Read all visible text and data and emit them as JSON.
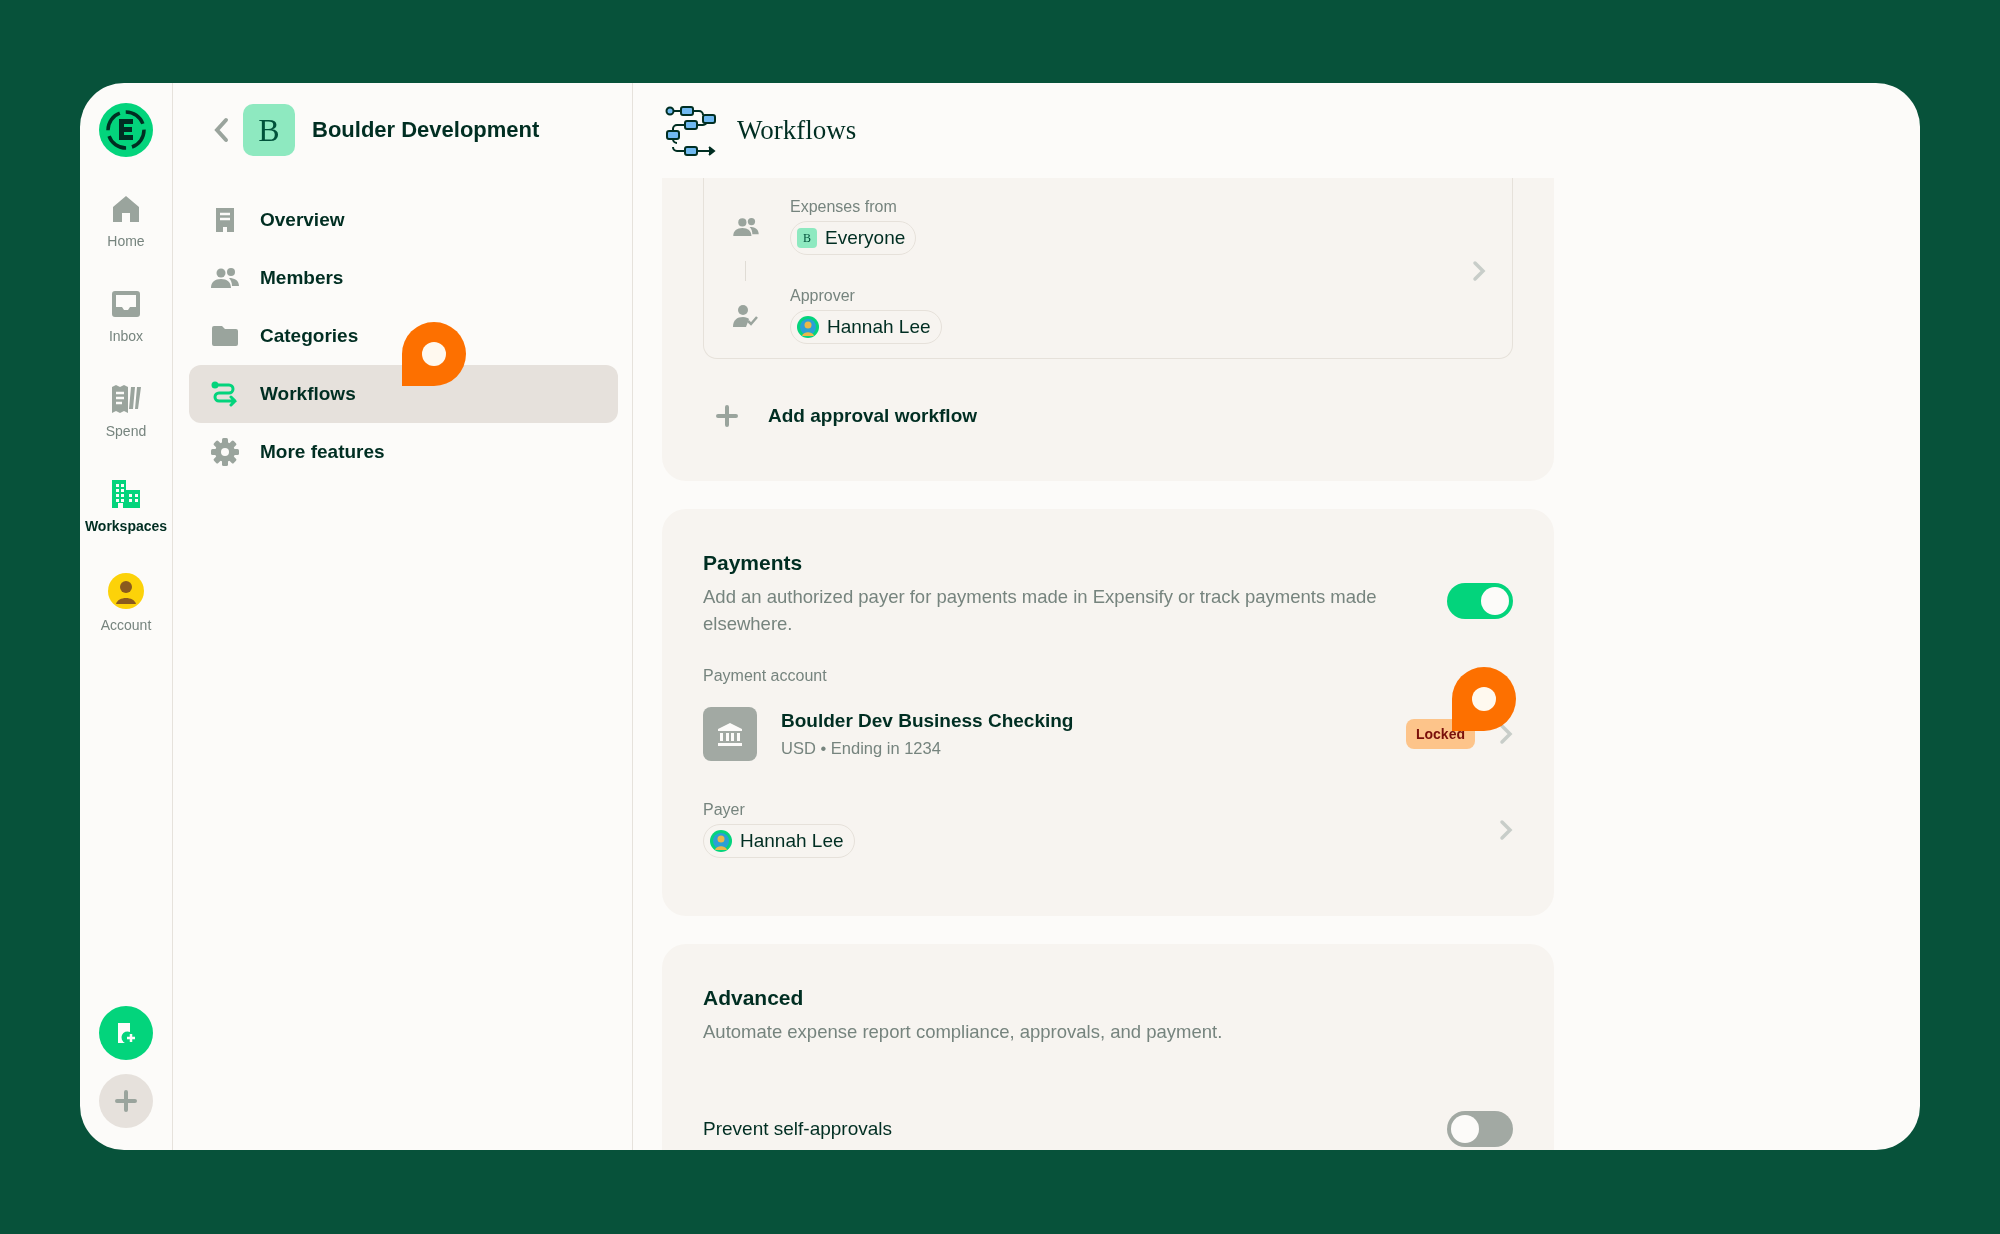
{
  "rail": {
    "items": [
      {
        "label": "Home",
        "kind": "home",
        "selected": false
      },
      {
        "label": "Inbox",
        "kind": "inbox",
        "selected": false
      },
      {
        "label": "Spend",
        "kind": "spend",
        "selected": false
      },
      {
        "label": "Workspaces",
        "kind": "workspaces",
        "selected": true
      },
      {
        "label": "Account",
        "kind": "account",
        "selected": false
      }
    ]
  },
  "workspace": {
    "initial": "B",
    "name": "Boulder Development"
  },
  "menu": [
    {
      "label": "Overview",
      "kind": "overview",
      "selected": false
    },
    {
      "label": "Members",
      "kind": "members",
      "selected": false
    },
    {
      "label": "Categories",
      "kind": "categories",
      "selected": false
    },
    {
      "label": "Workflows",
      "kind": "workflows",
      "selected": true
    },
    {
      "label": "More features",
      "kind": "features",
      "selected": false
    }
  ],
  "page": {
    "title": "Workflows"
  },
  "approval": {
    "steps": [
      {
        "label": "Expenses from",
        "kind": "submitters",
        "chip": "Everyone",
        "chip_initial": "B"
      },
      {
        "label": "Approver",
        "kind": "approver",
        "chip": "Hannah Lee"
      }
    ],
    "add": "Add approval workflow"
  },
  "payments": {
    "title": "Payments",
    "description": "Add an authorized payer for payments made in Expensify or track payments made elsewhere.",
    "on": true,
    "account_label": "Payment account",
    "account_name": "Boulder Dev Business Checking",
    "account_detail": "USD • Ending in 1234",
    "badge": "Locked",
    "payer_label": "Payer",
    "payer": "Hannah Lee"
  },
  "advanced": {
    "title": "Advanced",
    "description": "Automate expense report compliance, approvals, and payment.",
    "settings": [
      {
        "label": "Prevent self-approvals",
        "on": false
      }
    ]
  }
}
